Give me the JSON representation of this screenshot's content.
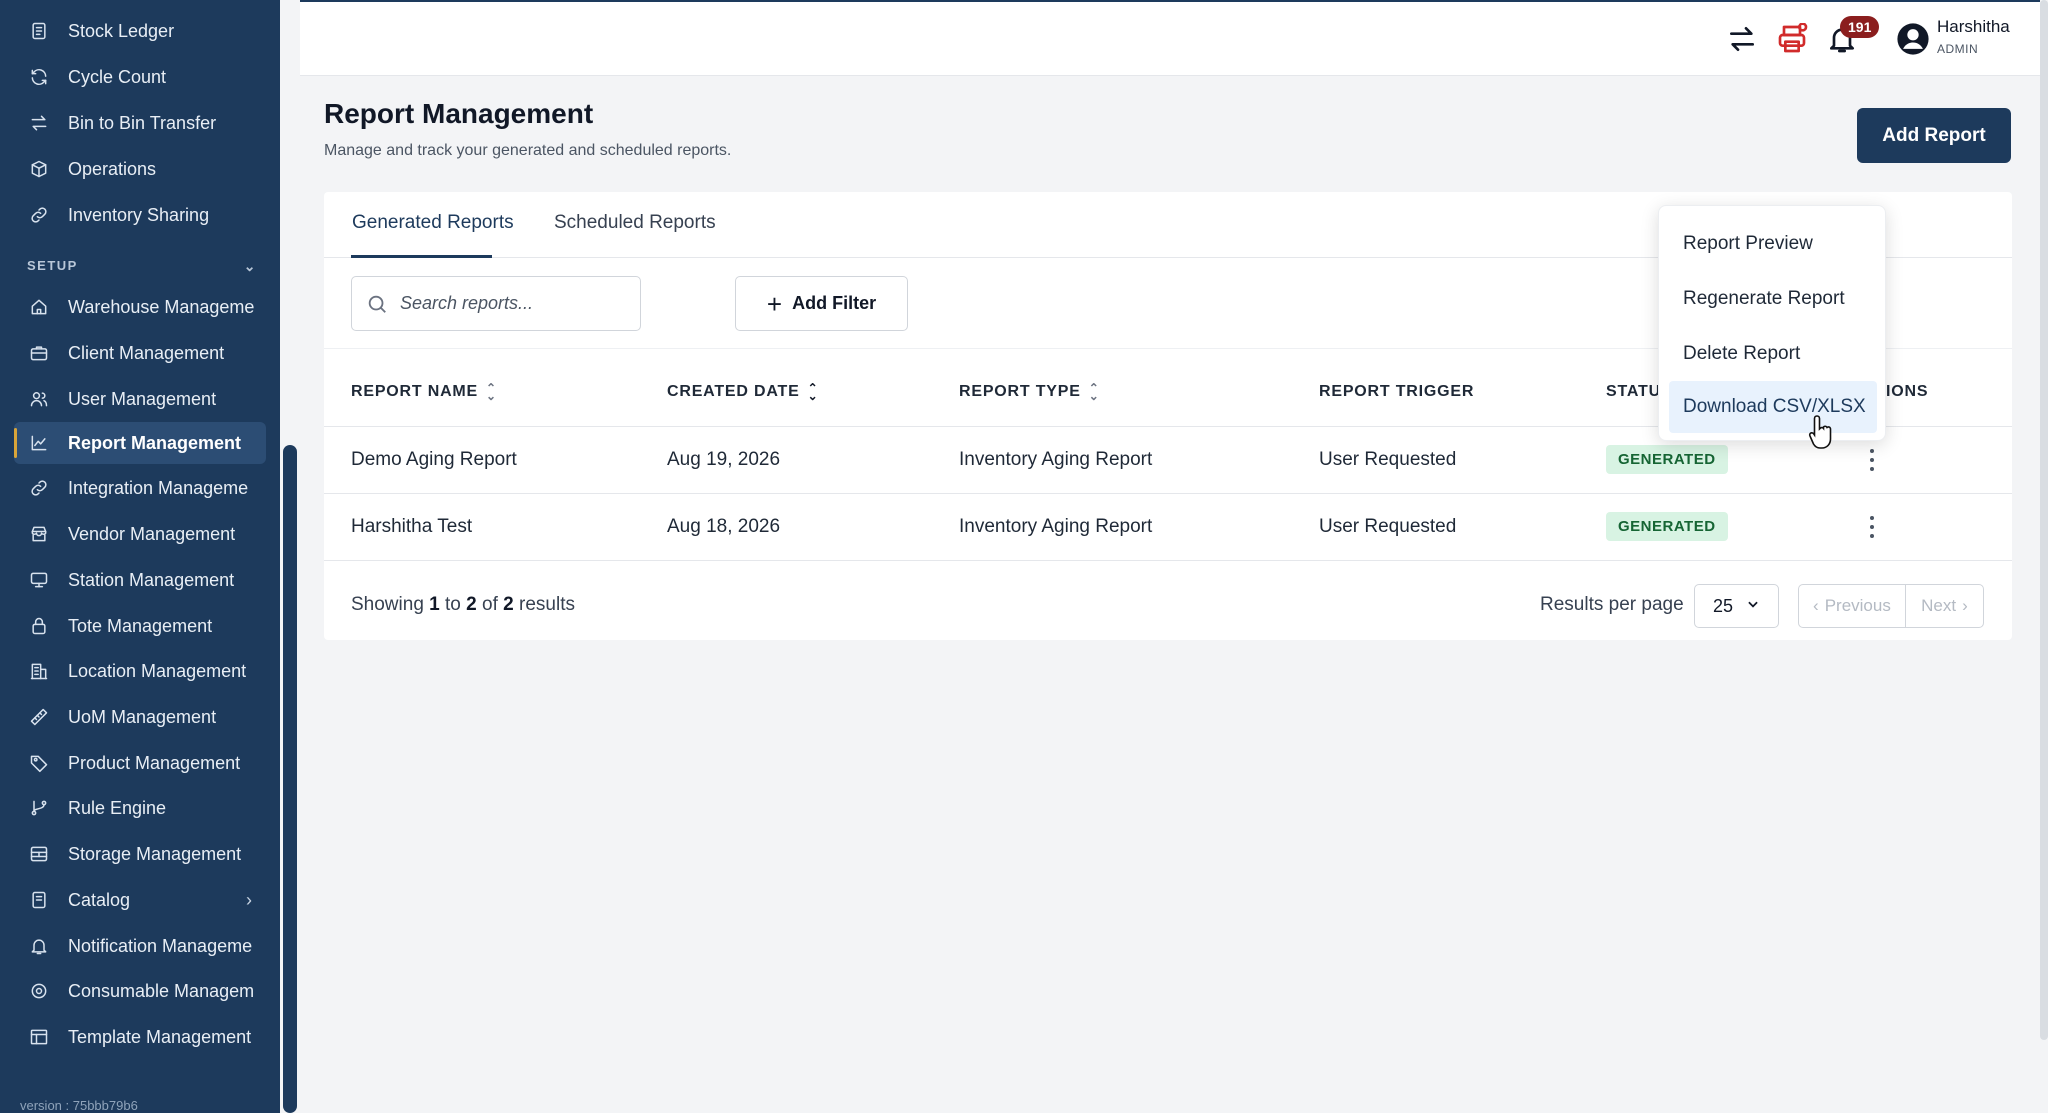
{
  "sidebar": {
    "items_top": [
      {
        "label": "Stock Ledger",
        "icon": "ledger-icon"
      },
      {
        "label": "Cycle Count",
        "icon": "refresh-icon"
      },
      {
        "label": "Bin to Bin Transfer",
        "icon": "transfer-icon"
      },
      {
        "label": "Operations",
        "icon": "box-icon"
      },
      {
        "label": "Inventory Sharing",
        "icon": "link-icon"
      }
    ],
    "section_label": "SETUP",
    "items": [
      {
        "label": "Warehouse Manageme",
        "icon": "home-icon"
      },
      {
        "label": "Client Management",
        "icon": "briefcase-icon"
      },
      {
        "label": "User Management",
        "icon": "users-icon"
      },
      {
        "label": "Report Management",
        "icon": "chart-line-icon",
        "active": true
      },
      {
        "label": "Integration Manageme",
        "icon": "link-icon"
      },
      {
        "label": "Vendor Management",
        "icon": "store-icon"
      },
      {
        "label": "Station Management",
        "icon": "monitor-icon"
      },
      {
        "label": "Tote Management",
        "icon": "lock-icon"
      },
      {
        "label": "Location Management",
        "icon": "building-icon"
      },
      {
        "label": "UoM Management",
        "icon": "ruler-icon"
      },
      {
        "label": "Product Management",
        "icon": "tag-icon"
      },
      {
        "label": "Rule Engine",
        "icon": "branch-icon"
      },
      {
        "label": "Storage Management",
        "icon": "storage-icon"
      },
      {
        "label": "Catalog",
        "icon": "catalog-icon"
      },
      {
        "label": "Notification Manageme",
        "icon": "bell-icon"
      },
      {
        "label": "Consumable Managem",
        "icon": "at-icon"
      },
      {
        "label": "Template Management",
        "icon": "table-icon"
      }
    ],
    "version": "version : 75bbb79b6"
  },
  "topbar": {
    "notification_count": "191",
    "user_name": "Harshitha",
    "user_role": "ADMIN"
  },
  "page": {
    "title": "Report Management",
    "subtitle": "Manage and track your generated and scheduled reports.",
    "add_button": "Add Report"
  },
  "tabs": [
    "Generated Reports",
    "Scheduled Reports"
  ],
  "toolbar": {
    "search_placeholder": "Search reports...",
    "add_filter": "Add Filter"
  },
  "table": {
    "columns": [
      "REPORT NAME",
      "CREATED DATE",
      "REPORT TYPE",
      "REPORT TRIGGER",
      "STATU",
      "IONS"
    ],
    "rows": [
      {
        "name": "Demo Aging Report",
        "date": "Aug 19, 2026",
        "type": "Inventory Aging Report",
        "trigger": "User Requested",
        "status": "GENERATED"
      },
      {
        "name": "Harshitha Test",
        "date": "Aug 18, 2026",
        "type": "Inventory Aging Report",
        "trigger": "User Requested",
        "status": "GENERATED"
      }
    ]
  },
  "pagination": {
    "showing_prefix": "Showing",
    "from": "1",
    "to_word": "to",
    "to": "2",
    "of_word": "of",
    "total": "2",
    "suffix": "results",
    "per_page_label": "Results per page",
    "per_page": "25",
    "previous": "Previous",
    "next": "Next"
  },
  "menu": {
    "items": [
      "Report Preview",
      "Regenerate Report",
      "Delete Report",
      "Download CSV/XLSX"
    ]
  },
  "colors": {
    "sidebar_bg": "#1d3a5c",
    "primary": "#1d3a5c",
    "status_bg": "#d8f3e3",
    "status_text": "#166534",
    "badge": "#8b1e1e",
    "printer_icon": "#d12b2b"
  }
}
